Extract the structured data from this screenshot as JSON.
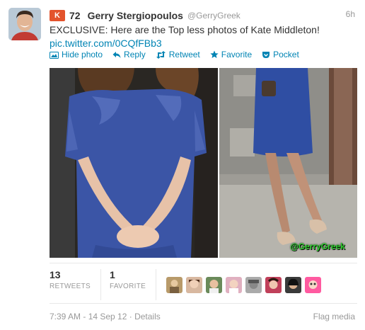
{
  "author": {
    "klout_score": "72",
    "name": "Gerry Stergiopoulos",
    "handle": "@GerryGreek",
    "time_ago": "6h"
  },
  "tweet": {
    "text": "EXCLUSIVE: Here are the Top less photos of Kate Middleton!",
    "link": "pic.twitter.com/0CQfFBb3"
  },
  "actions": {
    "hide_photo": "Hide photo",
    "reply": "Reply",
    "retweet": "Retweet",
    "favorite": "Favorite",
    "pocket": "Pocket"
  },
  "media": {
    "watermark": "@GerryGreek"
  },
  "stats": {
    "retweets_count": "13",
    "retweets_label": "RETWEETS",
    "favorites_count": "1",
    "favorites_label": "FAVORITE"
  },
  "footer": {
    "date": "7:39 AM - 14 Sep 12 · Details",
    "flag": "Flag media"
  },
  "colors": {
    "link": "#0084b4",
    "klout": "#e3532c",
    "dress": "#3b55a6"
  },
  "icons": [
    "klout-icon",
    "photo-icon",
    "reply-icon",
    "retweet-icon",
    "favorite-star-icon",
    "pocket-icon"
  ]
}
